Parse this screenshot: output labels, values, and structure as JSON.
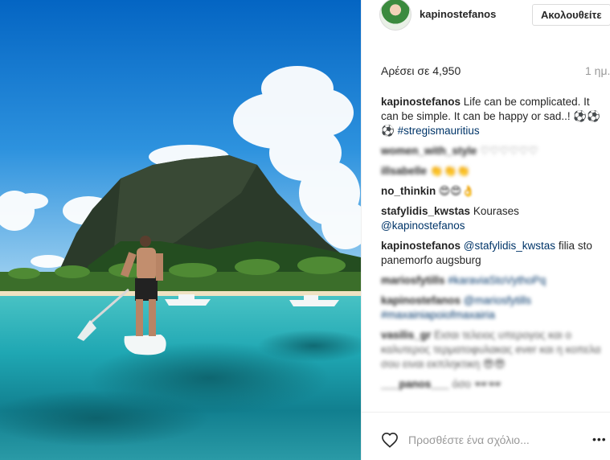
{
  "post": {
    "image_alt": "Person stand-up paddle boarding toward a mountain",
    "username": "kapinostefanos",
    "follow_label": "Ακολουθείτε",
    "likes": "Αρέσει σε 4,950",
    "timestamp": "1 ημ.",
    "caption": {
      "user": "kapinostefanos",
      "text": "Life can be complicated. It can be simple. It can be happy or sad..! ⚽⚽⚽",
      "hashtag": "#stregismauritius"
    },
    "comments": [
      {
        "user": "women_with_style",
        "text": "♡♡♡♡♡♡"
      },
      {
        "user": "illsabelle",
        "text": "👏👏👏"
      },
      {
        "user": "no_thinkin",
        "text": "😍😍👌"
      },
      {
        "user": "stafylidis_kwstas",
        "text": "Kourases",
        "mention": "@kapinostefanos"
      },
      {
        "user": "kapinostefanos",
        "mention": "@stafylidis_kwstas",
        "text": "filia sto panemorfo augsburg"
      },
      {
        "user": "mariosfytills",
        "tag": "#karaviaStoVythoPq"
      },
      {
        "user": "kapinostefanos",
        "mention": "@mariosfytills",
        "tag": "#maxainiapoiofmaxairia"
      },
      {
        "user": "vasilis_gr",
        "text": "Εισαι τελειος υπερογος και ο καλυτερος τερματοφυλακας ever και η κοπελα σου ειναι εκπληκτικη 😎😎"
      },
      {
        "user": "___panos___",
        "text": "όσο 🕶🕶"
      }
    ],
    "add_comment_placeholder": "Προσθέστε ένα σχόλιο...",
    "more_label": "•••"
  },
  "colors": {
    "link": "#003569",
    "muted": "#999999",
    "text": "#262626"
  },
  "icons": {
    "like": "heart-outline-icon",
    "more": "more-options-icon",
    "avatar": "profile-avatar"
  }
}
